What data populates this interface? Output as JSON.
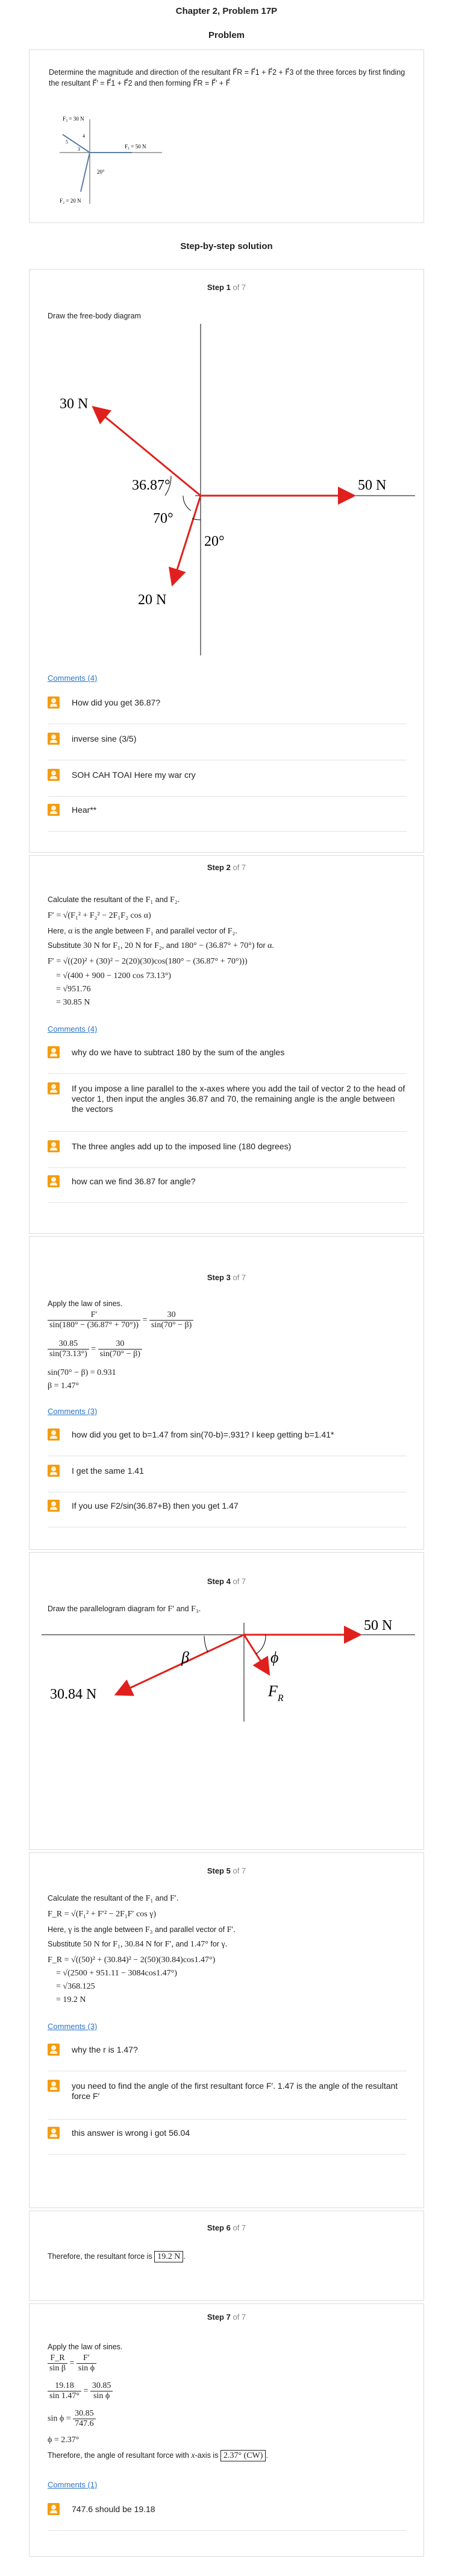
{
  "header": {
    "title": "Chapter 2, Problem 17P",
    "problem_label": "Problem"
  },
  "problem": {
    "text": "Determine the magnitude and direction of the resultant F⃗R = F⃗1 + F⃗2 + F⃗3 of the three forces by first finding the resultant F⃗′ = F⃗1 + F⃗2 and then forming F⃗R = F⃗′ + F⃗",
    "fig_labels": [
      "F₃ = 30 N",
      "F₁ = 50 N",
      "F₂ = 20 N",
      "20°",
      "5",
      "3",
      "4"
    ]
  },
  "solution_title": "Step-by-step solution",
  "of_total": "of 7",
  "steps": [
    {
      "label": "Step 1",
      "text": "Draw the free-body diagram",
      "diagram": {
        "f30": "30 N",
        "f50": "50 N",
        "f20": "20 N",
        "a1": "36.87°",
        "a2": "70°",
        "a3": "20°"
      },
      "comments_link": "Comments (4)",
      "comments": [
        "How did you get 36.87?",
        "inverse sine (3/5)",
        "SOH CAH TOAI Here my war cry",
        "Hear**"
      ]
    },
    {
      "label": "Step 2",
      "lines": {
        "l1a": "Calculate the resultant of the",
        "l1b": "F₁",
        "l1c": "and",
        "l1d": "F₂.",
        "eq1": "F′ = √(F₁² + F₂² − 2F₁F₂ cos α)",
        "l2a": "Here,",
        "l2b": "α",
        "l2c": "is the angle between",
        "l2d": "F₁",
        "l2e": "and parallel vector of",
        "l2f": "F₂.",
        "l3a": "Substitute",
        "l3b": "30 N",
        "l3c": "for",
        "l3d": "F₁,",
        "l3e": "20 N",
        "l3f": "for",
        "l3g": "F₂,",
        "l3h": "and",
        "l3i": "180° − (36.87° + 70°)",
        "l3j": "for",
        "l3k": "α.",
        "eq2": "F′ = √((20)² + (30)² − 2(20)(30)cos(180° − (36.87° + 70°)))",
        "eq3": "= √(400 + 900 − 1200 cos 73.13°)",
        "eq4": "= √951.76",
        "eq5": "= 30.85 N"
      },
      "comments_link": "Comments (4)",
      "comments": [
        "why do we have to subtract 180 by the sum of the angles",
        "If you impose a line parallel to the x-axes where you add the tail of vector 2 to the head of vector 1, then input the angles 36.87 and 70, the remaining angle is the angle between the vectors",
        "The three angles add up to the imposed line (180 degrees)",
        "how can we find 36.87 for angle?"
      ]
    },
    {
      "label": "Step 3",
      "lines": {
        "l1": "Apply the law of sines.",
        "f1n": "F′",
        "f1d": "sin(180° − (36.87° + 70°))",
        "eqs": "=",
        "f2n": "30",
        "f2d": "sin(70° − β)",
        "g1n": "30.85",
        "g1d": "sin(73.13°)",
        "g2n": "30",
        "g2d": "sin(70° − β)",
        "e3": "sin(70° − β) = 0.931",
        "e4": "β = 1.47°"
      },
      "comments_link": "Comments (3)",
      "comments": [
        "how did you get to b=1.47 from sin(70-b)=.931? I keep getting b=1.41*",
        "I get the same 1.41",
        "If you use F2/sin(36.87+B) then you get 1.47"
      ]
    },
    {
      "label": "Step 4",
      "text_a": "Draw the parallelogram diagram for",
      "text_b": "F′",
      "text_c": "and",
      "text_d": "F₃.",
      "diagram": {
        "f50": "50 N",
        "f30": "30.84 N",
        "beta": "β",
        "phi": "ϕ",
        "fr": "F",
        "frsub": "R"
      }
    },
    {
      "label": "Step 5",
      "lines": {
        "l1a": "Calculate the resultant of the",
        "l1b": "F₁",
        "l1c": "and",
        "l1d": "F′.",
        "eq1": "F_R = √(F₁² + F′² − 2F₁F′ cos γ)",
        "l2a": "Here,",
        "l2b": "γ",
        "l2c": "is the angle between",
        "l2d": "F₃",
        "l2e": "and parallel vector of",
        "l2f": "F′.",
        "l3a": "Substitute",
        "l3b": "50 N",
        "l3c": "for",
        "l3d": "F₁,",
        "l3e": "30.84 N",
        "l3f": "for",
        "l3g": "F′,",
        "l3h": "and",
        "l3i": "1.47°",
        "l3j": "for",
        "l3k": "γ.",
        "eq2": "F_R = √((50)² + (30.84)² − 2(50)(30.84)cos1.47°)",
        "eq3": "= √(2500 + 951.11 − 3084cos1.47°)",
        "eq4": "= √368.125",
        "eq5": "= 19.2 N"
      },
      "comments_link": "Comments (3)",
      "comments": [
        "why the r is 1.47?",
        "you need to find the angle of the first resultant force F′. 1.47 is the angle of the resultant force F′",
        "this answer is wrong i got 56.04"
      ]
    },
    {
      "label": "Step 6",
      "text": "Therefore, the resultant force is",
      "value": "19.2 N",
      "tail": "."
    },
    {
      "label": "Step 7",
      "lines": {
        "l1": "Apply the law of sines.",
        "f1n": "F_R",
        "f1d": "sin β",
        "eqs": "=",
        "f2n": "F′",
        "f2d": "sin ϕ",
        "g1n": "19.18",
        "g1d": "sin 1.47°",
        "g2n": "30.85",
        "g2d": "sin ϕ",
        "e3a": "sin ϕ =",
        "e3n": "30.85",
        "e3d": "747.6",
        "e4": "ϕ = 2.37°",
        "final_a": "Therefore, the angle of resultant force with",
        "final_b": "x",
        "final_c": "-axis is",
        "final_val": "2.37° (CW)",
        "final_d": "."
      },
      "comments_link": "Comments (1)",
      "comments": [
        "747.6 should be 19.18"
      ]
    }
  ]
}
